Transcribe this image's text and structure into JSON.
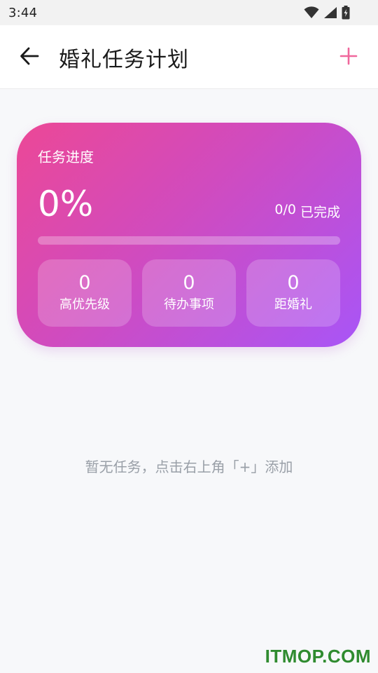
{
  "status_bar": {
    "time": "3:44",
    "icons": [
      "wifi-icon",
      "cell-signal-icon",
      "battery-charging-icon"
    ]
  },
  "header": {
    "title": "婚礼任务计划",
    "back_icon": "arrow-left-icon",
    "add_icon": "plus-icon",
    "accent_color": "#f0679c"
  },
  "progress_card": {
    "title": "任务进度",
    "percent_text": "0%",
    "progress_fraction": 0,
    "completed_count": "0/0",
    "completed_label": "已完成",
    "gradient_colors": [
      "#ec4896",
      "#a855f7"
    ],
    "stats": [
      {
        "value": "0",
        "label": "高优先级"
      },
      {
        "value": "0",
        "label": "待办事项"
      },
      {
        "value": "0",
        "label": "距婚礼"
      }
    ]
  },
  "empty_state": {
    "message": "暂无任务，点击右上角「+」添加"
  },
  "watermark": {
    "text": "ITMOP.COM"
  }
}
